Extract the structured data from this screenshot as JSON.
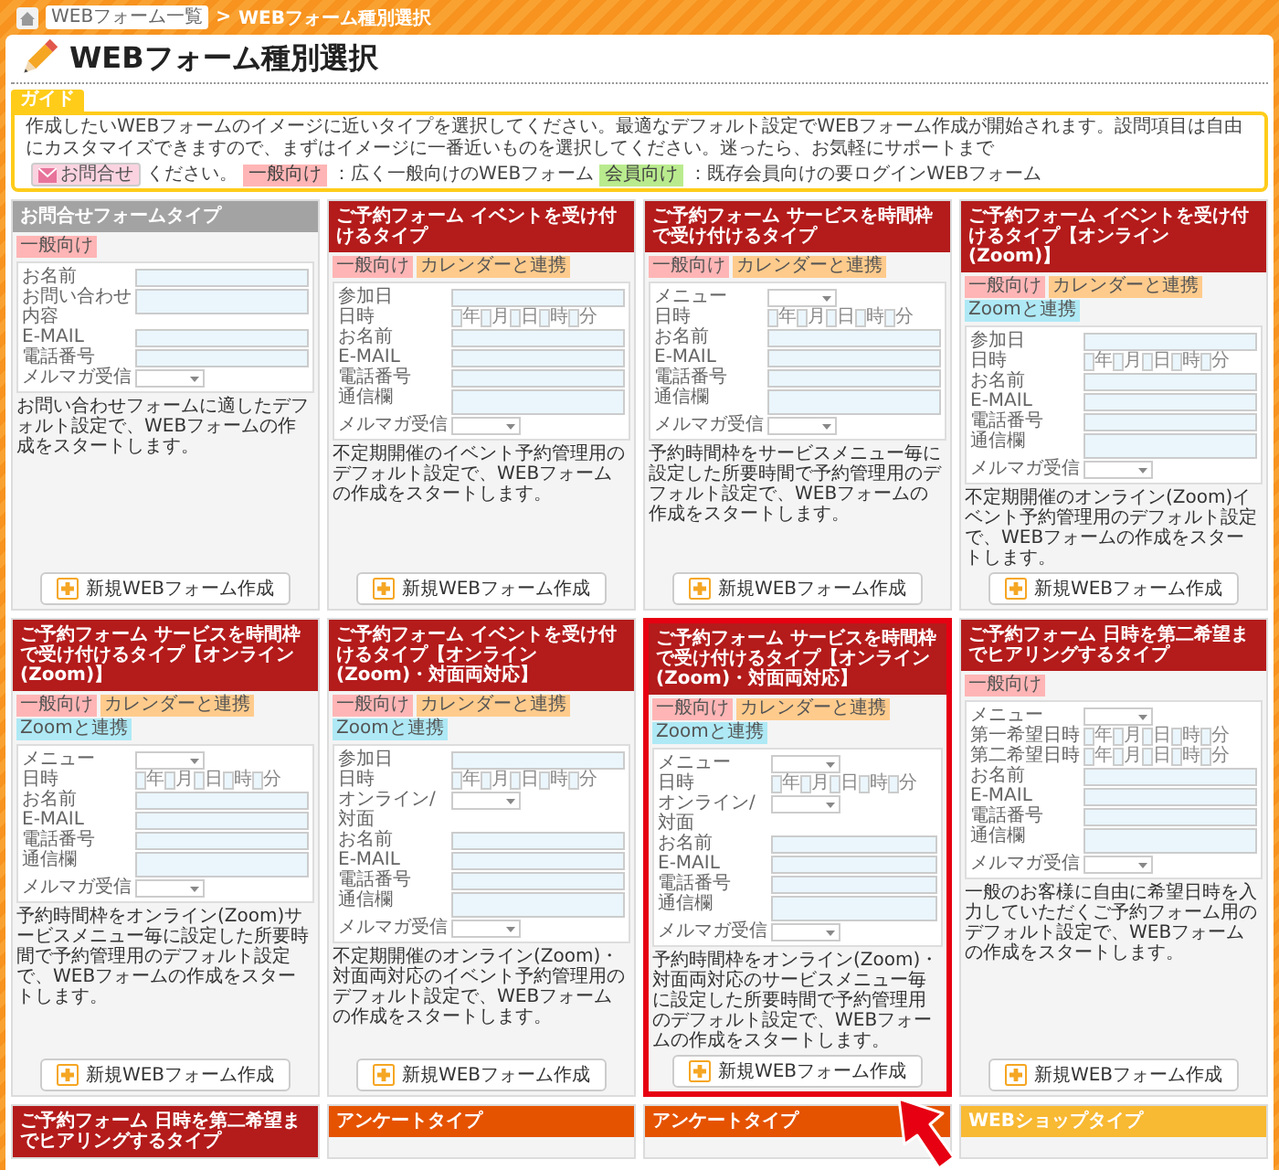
{
  "breadcrumb": {
    "items": [
      {
        "label": "WEBフォーム一覧",
        "link": true
      },
      {
        "label": "WEBフォーム種別選択",
        "link": false
      }
    ],
    "separator": ">"
  },
  "page_title": "WEBフォーム種別選択",
  "guide": {
    "label": "ガイド",
    "segments": [
      {
        "kind": "text",
        "text": "作成したいWEBフォームのイメージに近いタイプを選択してください。最適なデフォルト設定でWEBフォーム作成が開始されます。設問項目は自由にカスタマイズできますので、まずはイメージに一番近いものを選択してください。迷ったら、お気軽にサポートまで"
      },
      {
        "kind": "button",
        "text": "お問合せ",
        "color": "#fbd3e0"
      },
      {
        "kind": "text",
        "text": "ください。"
      },
      {
        "kind": "badge",
        "text": "一般向け",
        "color": "#ffb5b5"
      },
      {
        "kind": "text",
        "text": "：広く一般向けのWEBフォーム"
      },
      {
        "kind": "badge",
        "text": "会員向け",
        "color": "#b9eb8e"
      },
      {
        "kind": "text",
        "text": "：既存会員向けの要ログインWEBフォーム"
      }
    ]
  },
  "cards": [
    {
      "title": "お問合せフォームタイプ",
      "color": "#a3a3a3",
      "highlighted": false,
      "tags": [
        {
          "label": "一般向け",
          "color": "#ffb5b5"
        }
      ],
      "fields": [
        {
          "label": "お名前",
          "kind": "text"
        },
        {
          "label": "お問い合わせ内容",
          "kind": "textarea"
        },
        {
          "label": "E-MAIL",
          "kind": "text"
        },
        {
          "label": "電話番号",
          "kind": "text"
        },
        {
          "label": "メルマガ受信",
          "kind": "select"
        }
      ],
      "description": "お問い合わせフォームに適したデフォルト設定で、WEBフォームの作成をスタートします。",
      "button": "新規WEBフォーム作成"
    },
    {
      "title": "ご予約フォーム イベントを受け付けるタイプ",
      "color": "#b41b1b",
      "highlighted": false,
      "tags": [
        {
          "label": "一般向け",
          "color": "#ffb5b5"
        },
        {
          "label": "カレンダーと連携",
          "color": "#ffcb8c"
        }
      ],
      "fields": [
        {
          "label": "参加日",
          "kind": "text"
        },
        {
          "label": "日時",
          "kind": "datetime",
          "units": [
            "年",
            "月",
            "日",
            "時",
            "分"
          ]
        },
        {
          "label": "お名前",
          "kind": "text"
        },
        {
          "label": "E-MAIL",
          "kind": "text"
        },
        {
          "label": "電話番号",
          "kind": "text"
        },
        {
          "label": "通信欄",
          "kind": "textarea"
        },
        {
          "label": "メルマガ受信",
          "kind": "select"
        }
      ],
      "description": "不定期開催のイベント予約管理用のデフォルト設定で、WEBフォームの作成をスタートします。",
      "button": "新規WEBフォーム作成"
    },
    {
      "title": "ご予約フォーム サービスを時間枠で受け付けるタイプ",
      "color": "#b41b1b",
      "highlighted": false,
      "tags": [
        {
          "label": "一般向け",
          "color": "#ffb5b5"
        },
        {
          "label": "カレンダーと連携",
          "color": "#ffcb8c"
        }
      ],
      "fields": [
        {
          "label": "メニュー",
          "kind": "select"
        },
        {
          "label": "日時",
          "kind": "datetime",
          "units": [
            "年",
            "月",
            "日",
            "時",
            "分"
          ]
        },
        {
          "label": "お名前",
          "kind": "text"
        },
        {
          "label": "E-MAIL",
          "kind": "text"
        },
        {
          "label": "電話番号",
          "kind": "text"
        },
        {
          "label": "通信欄",
          "kind": "textarea"
        },
        {
          "label": "メルマガ受信",
          "kind": "select"
        }
      ],
      "description": "予約時間枠をサービスメニュー毎に設定した所要時間で予約管理用のデフォルト設定で、WEBフォームの作成をスタートします。",
      "button": "新規WEBフォーム作成"
    },
    {
      "title": "ご予約フォーム イベントを受け付けるタイプ【オンライン(Zoom)】",
      "color": "#b41b1b",
      "highlighted": false,
      "tags": [
        {
          "label": "一般向け",
          "color": "#ffb5b5"
        },
        {
          "label": "カレンダーと連携",
          "color": "#ffcb8c"
        },
        {
          "label": "Zoomと連携",
          "color": "#aee9f5"
        }
      ],
      "fields": [
        {
          "label": "参加日",
          "kind": "text"
        },
        {
          "label": "日時",
          "kind": "datetime",
          "units": [
            "年",
            "月",
            "日",
            "時",
            "分"
          ]
        },
        {
          "label": "お名前",
          "kind": "text"
        },
        {
          "label": "E-MAIL",
          "kind": "text"
        },
        {
          "label": "電話番号",
          "kind": "text"
        },
        {
          "label": "通信欄",
          "kind": "textarea"
        },
        {
          "label": "メルマガ受信",
          "kind": "select"
        }
      ],
      "description": "不定期開催のオンライン(Zoom)イベント予約管理用のデフォルト設定で、WEBフォームの作成をスタートします。",
      "button": "新規WEBフォーム作成"
    },
    {
      "title": "ご予約フォーム サービスを時間枠で受け付けるタイプ【オンライン(Zoom)】",
      "color": "#b41b1b",
      "highlighted": false,
      "tags": [
        {
          "label": "一般向け",
          "color": "#ffb5b5"
        },
        {
          "label": "カレンダーと連携",
          "color": "#ffcb8c"
        },
        {
          "label": "Zoomと連携",
          "color": "#aee9f5"
        }
      ],
      "fields": [
        {
          "label": "メニュー",
          "kind": "select"
        },
        {
          "label": "日時",
          "kind": "datetime",
          "units": [
            "年",
            "月",
            "日",
            "時",
            "分"
          ]
        },
        {
          "label": "お名前",
          "kind": "text"
        },
        {
          "label": "E-MAIL",
          "kind": "text"
        },
        {
          "label": "電話番号",
          "kind": "text"
        },
        {
          "label": "通信欄",
          "kind": "textarea"
        },
        {
          "label": "メルマガ受信",
          "kind": "select"
        }
      ],
      "description": "予約時間枠をオンライン(Zoom)サービスメニュー毎に設定した所要時間で予約管理用のデフォルト設定で、WEBフォームの作成をスタートします。",
      "button": "新規WEBフォーム作成"
    },
    {
      "title": "ご予約フォーム イベントを受け付けるタイプ【オンライン(Zoom)・対面両対応】",
      "color": "#b41b1b",
      "highlighted": false,
      "tags": [
        {
          "label": "一般向け",
          "color": "#ffb5b5"
        },
        {
          "label": "カレンダーと連携",
          "color": "#ffcb8c"
        },
        {
          "label": "Zoomと連携",
          "color": "#aee9f5"
        }
      ],
      "fields": [
        {
          "label": "参加日",
          "kind": "text"
        },
        {
          "label": "日時",
          "kind": "datetime",
          "units": [
            "年",
            "月",
            "日",
            "時",
            "分"
          ]
        },
        {
          "label": "オンライン/対面",
          "kind": "select"
        },
        {
          "label": "お名前",
          "kind": "text"
        },
        {
          "label": "E-MAIL",
          "kind": "text"
        },
        {
          "label": "電話番号",
          "kind": "text"
        },
        {
          "label": "通信欄",
          "kind": "textarea"
        },
        {
          "label": "メルマガ受信",
          "kind": "select"
        }
      ],
      "description": "不定期開催のオンライン(Zoom)・対面両対応のイベント予約管理用のデフォルト設定で、WEBフォームの作成をスタートします。",
      "button": "新規WEBフォーム作成"
    },
    {
      "title": "ご予約フォーム サービスを時間枠で受け付けるタイプ【オンライン(Zoom)・対面両対応】",
      "color": "#b41b1b",
      "highlighted": true,
      "tags": [
        {
          "label": "一般向け",
          "color": "#ffb5b5"
        },
        {
          "label": "カレンダーと連携",
          "color": "#ffcb8c"
        },
        {
          "label": "Zoomと連携",
          "color": "#aee9f5"
        }
      ],
      "fields": [
        {
          "label": "メニュー",
          "kind": "select"
        },
        {
          "label": "日時",
          "kind": "datetime",
          "units": [
            "年",
            "月",
            "日",
            "時",
            "分"
          ]
        },
        {
          "label": "オンライン/対面",
          "kind": "select"
        },
        {
          "label": "お名前",
          "kind": "text"
        },
        {
          "label": "E-MAIL",
          "kind": "text"
        },
        {
          "label": "電話番号",
          "kind": "text"
        },
        {
          "label": "通信欄",
          "kind": "textarea"
        },
        {
          "label": "メルマガ受信",
          "kind": "select"
        }
      ],
      "description": "予約時間枠をオンライン(Zoom)・対面両対応のサービスメニュー毎に設定した所要時間で予約管理用のデフォルト設定で、WEBフォームの作成をスタートします。",
      "button": "新規WEBフォーム作成"
    },
    {
      "title": "ご予約フォーム 日時を第二希望までヒアリングするタイプ",
      "color": "#b41b1b",
      "highlighted": false,
      "tags": [
        {
          "label": "一般向け",
          "color": "#ffb5b5"
        }
      ],
      "fields": [
        {
          "label": "メニュー",
          "kind": "select"
        },
        {
          "label": "第一希望日時",
          "kind": "datetime",
          "units": [
            "年",
            "月",
            "日",
            "時",
            "分"
          ]
        },
        {
          "label": "第二希望日時",
          "kind": "datetime",
          "units": [
            "年",
            "月",
            "日",
            "時",
            "分"
          ]
        },
        {
          "label": "お名前",
          "kind": "text"
        },
        {
          "label": "E-MAIL",
          "kind": "text"
        },
        {
          "label": "電話番号",
          "kind": "text"
        },
        {
          "label": "通信欄",
          "kind": "textarea"
        },
        {
          "label": "メルマガ受信",
          "kind": "select"
        }
      ],
      "description": "一般のお客様に自由に希望日時を入力していただくご予約フォーム用のデフォルト設定で、WEBフォームの作成をスタートします。",
      "button": "新規WEBフォーム作成"
    },
    {
      "title": "ご予約フォーム 日時を第二希望までヒアリングするタイプ",
      "color": "#b41b1b"
    },
    {
      "title": "アンケートタイプ",
      "color": "#e55300"
    },
    {
      "title": "アンケートタイプ",
      "color": "#e55300"
    },
    {
      "title": "WEBショップタイプ",
      "color": "#f8b933"
    }
  ]
}
